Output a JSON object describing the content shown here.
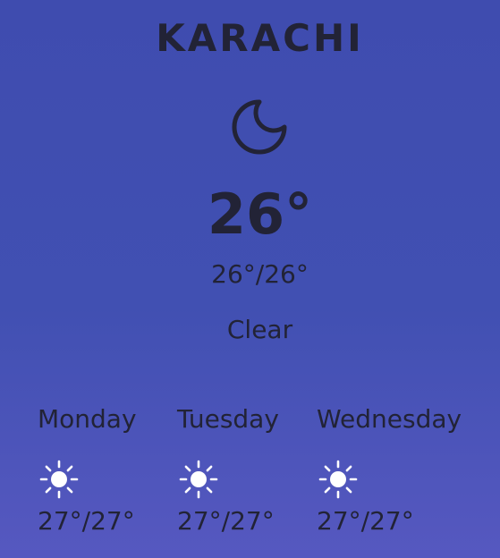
{
  "city": "KARACHI",
  "current": {
    "icon": "moon-icon",
    "temperature": "26°",
    "range": "26°/26°",
    "condition": "Clear"
  },
  "forecast": [
    {
      "day": "Monday",
      "icon": "sun-icon",
      "range": "27°/27°"
    },
    {
      "day": "Tuesday",
      "icon": "sun-icon",
      "range": "27°/27°"
    },
    {
      "day": "Wednesday",
      "icon": "sun-icon",
      "range": "27°/27°"
    }
  ],
  "colors": {
    "background_top": "#3f4caf",
    "background_bottom": "#5658c0",
    "text": "#222336",
    "forecast_icon": "#ffffff"
  }
}
